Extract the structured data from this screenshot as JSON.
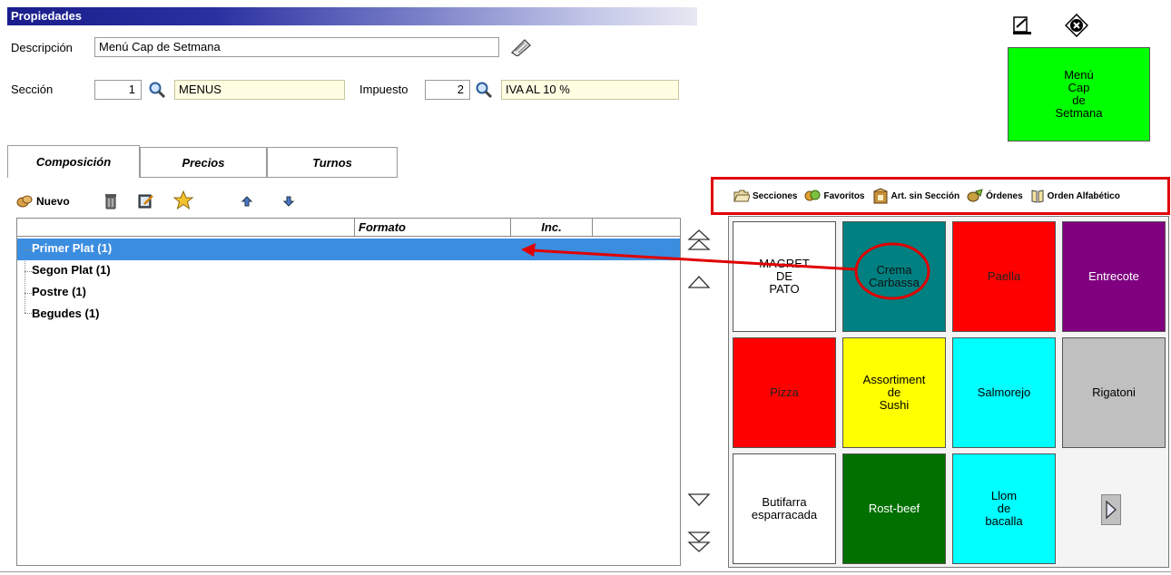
{
  "window": {
    "title": "Propiedades"
  },
  "form": {
    "descripcion_label": "Descripción",
    "descripcion_value": "Menú Cap de Setmana",
    "seccion_label": "Sección",
    "seccion_num": "1",
    "seccion_name": "MENUS",
    "impuesto_label": "Impuesto",
    "impuesto_num": "2",
    "impuesto_name": "IVA AL 10 %"
  },
  "menu_tile": {
    "label": "Menú\nCap\nde\nSetmana",
    "color": "#00ff00"
  },
  "tabs": [
    {
      "label": "Composición",
      "active": true
    },
    {
      "label": "Precios",
      "active": false
    },
    {
      "label": "Turnos",
      "active": false
    }
  ],
  "toolbar": {
    "nuevo_label": "Nuevo"
  },
  "list": {
    "columns": [
      "",
      "Formato",
      "Inc."
    ],
    "rows": [
      "Primer Plat (1)",
      "Segon Plat (1)",
      "Postre (1)",
      "Begudes (1)"
    ],
    "selected_index": 0
  },
  "right_toolbar": {
    "items": [
      "Secciones",
      "Favoritos",
      "Art. sin Sección",
      "Órdenes",
      "Orden Alfabético"
    ]
  },
  "products": [
    {
      "label": "MAGRET\nDE\nPATO",
      "color": "#ffffff"
    },
    {
      "label": "Crema\nCarbassa",
      "color": "#008080"
    },
    {
      "label": "Paella",
      "color": "#ff0000"
    },
    {
      "label": "Entrecote",
      "color": "#800080"
    },
    {
      "label": "Pizza",
      "color": "#ff0000"
    },
    {
      "label": "Assortiment\nde\nSushi",
      "color": "#ffff00"
    },
    {
      "label": "Salmorejo",
      "color": "#00ffff"
    },
    {
      "label": "Rigatoni",
      "color": "#c0c0c0"
    },
    {
      "label": "Butifarra\nesparracada",
      "color": "#ffffff"
    },
    {
      "label": "Rost-beef",
      "color": "#007000"
    },
    {
      "label": "Llom\nde\nbacalla",
      "color": "#00ffff"
    }
  ],
  "colors": {
    "selection": "#3b8de0",
    "highlight": "#e00000"
  }
}
